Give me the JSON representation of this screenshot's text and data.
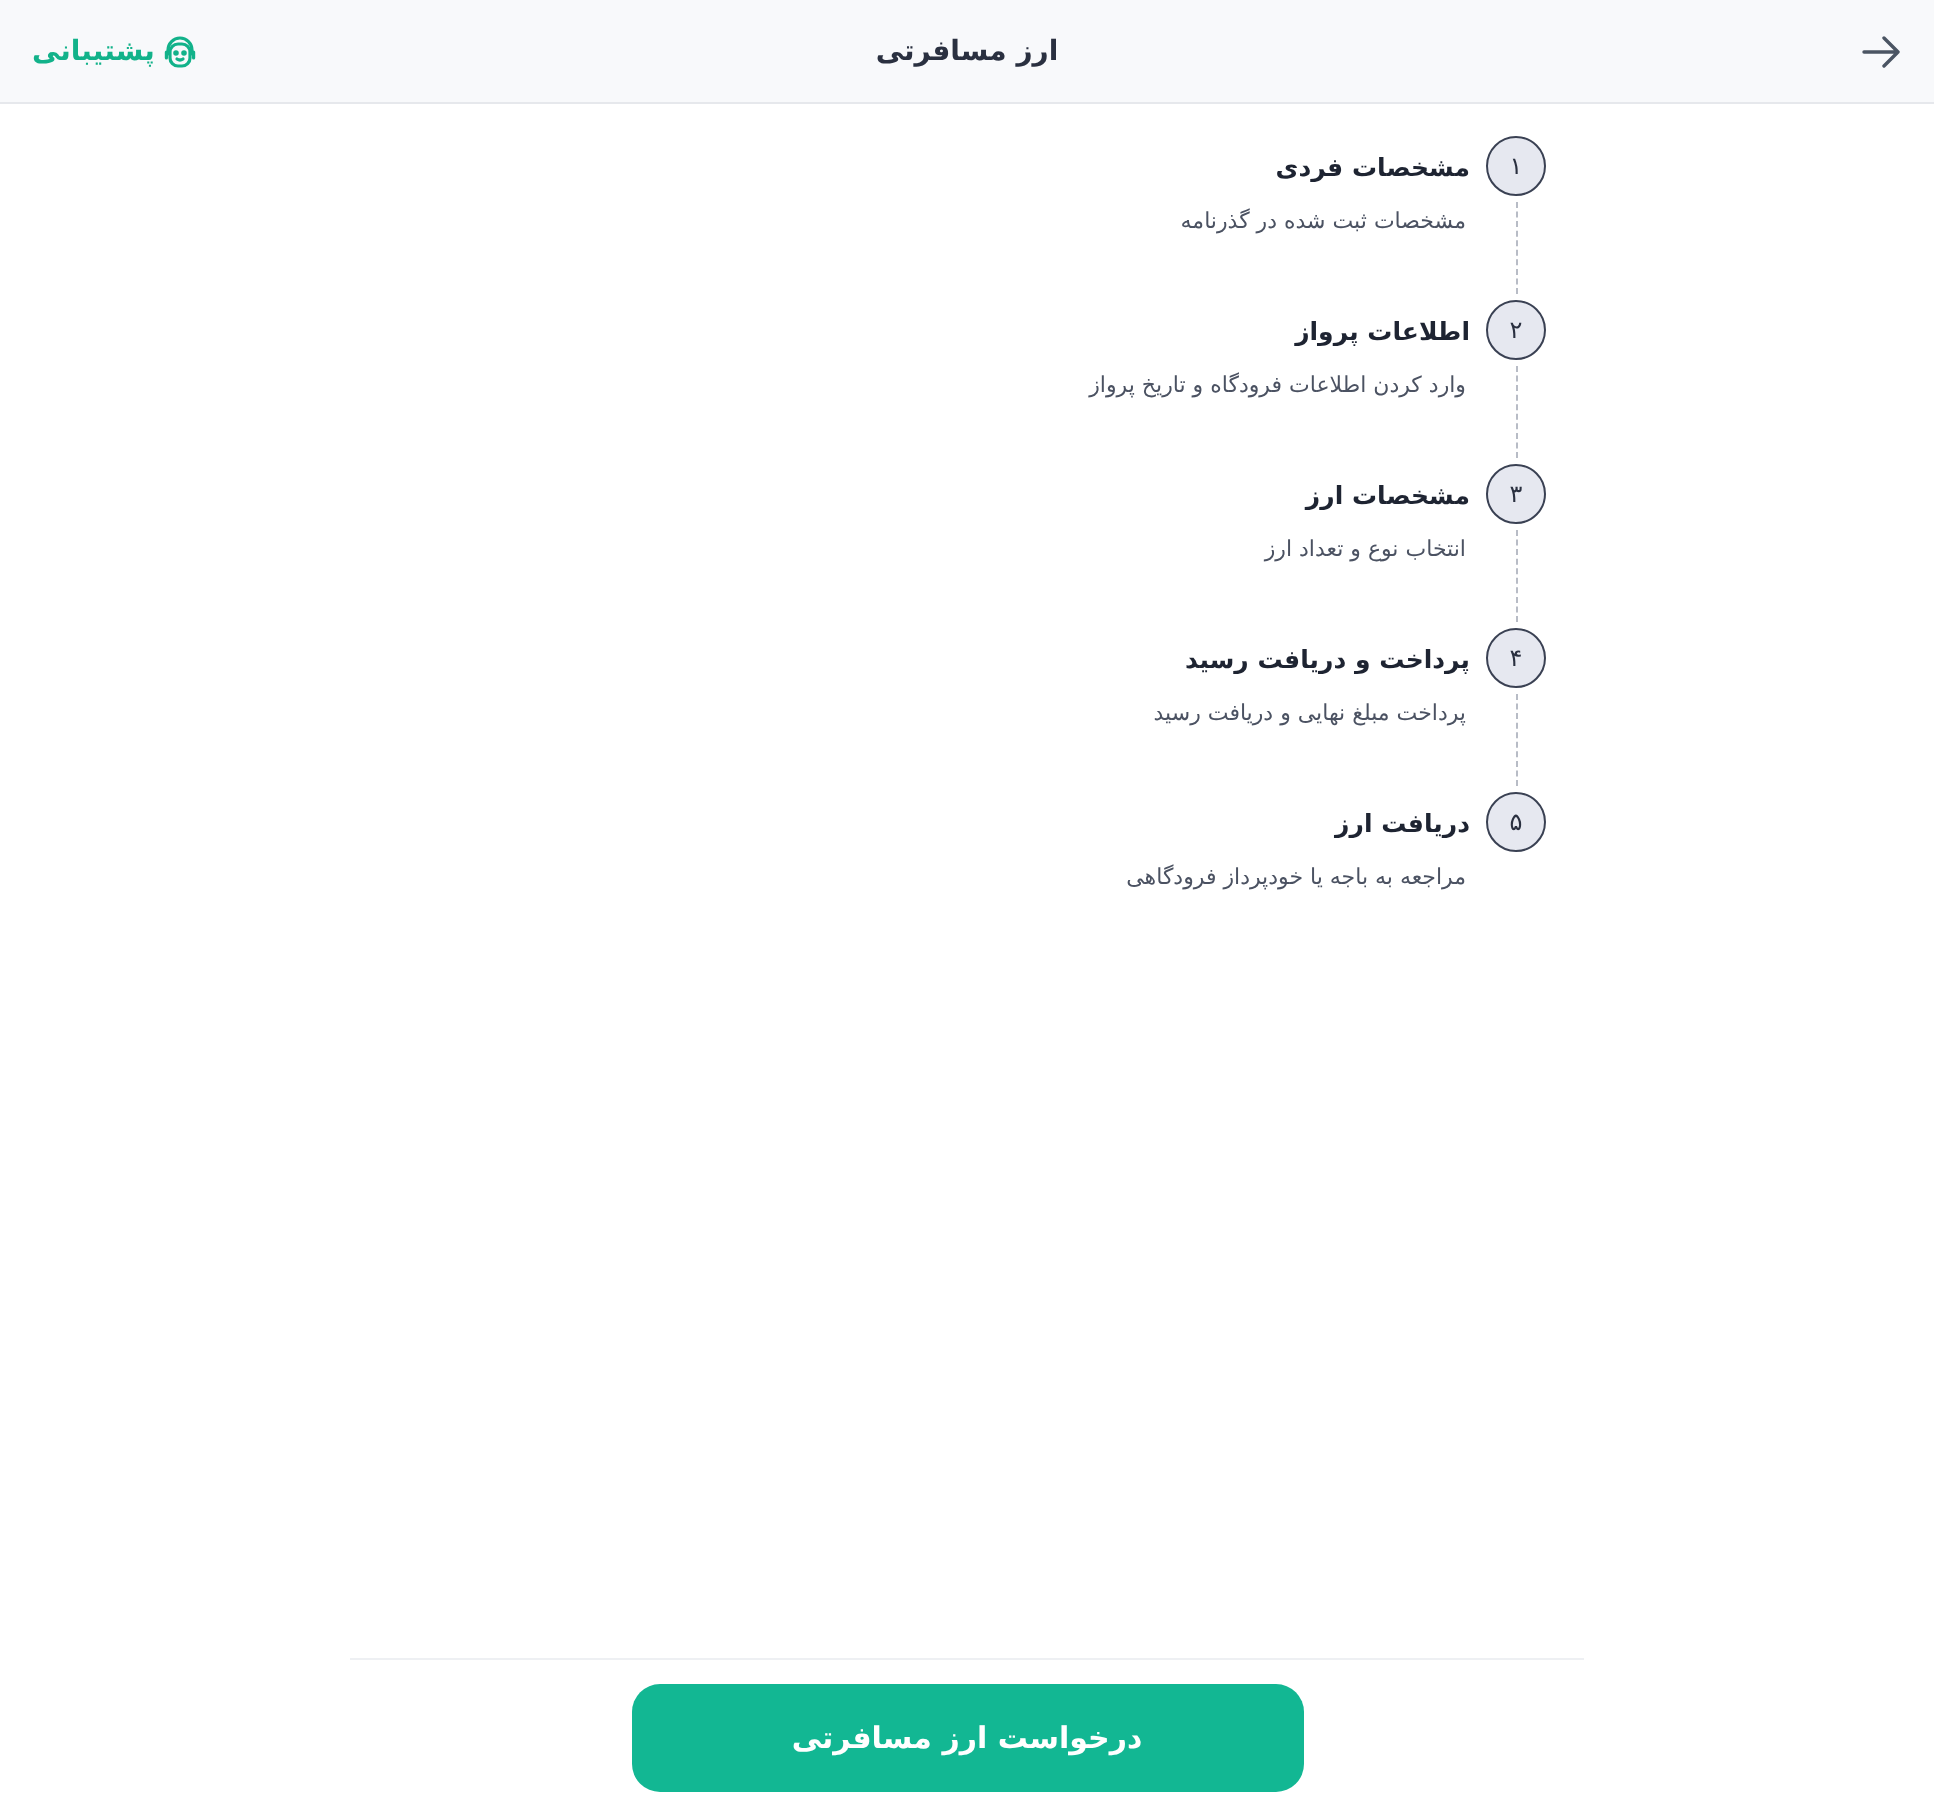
{
  "header": {
    "title": "ارز مسافرتی",
    "support_link": "پشتیبانی"
  },
  "steps": [
    {
      "number": "۱",
      "title": "مشخصات فردی",
      "description": "مشخصات ثبت شده در گذرنامه"
    },
    {
      "number": "۲",
      "title": "اطلاعات پرواز",
      "description": "وارد کردن اطلاعات فرودگاه و تاریخ پرواز"
    },
    {
      "number": "۳",
      "title": "مشخصات ارز",
      "description": "انتخاب نوع و تعداد ارز"
    },
    {
      "number": "۴",
      "title": "پرداخت و دریافت رسید",
      "description": "پرداخت مبلغ نهایی و دریافت رسید"
    },
    {
      "number": "۵",
      "title": "دریافت ارز",
      "description": "مراجعه به باجه یا خودپرداز فرودگاهی"
    }
  ],
  "primary_button": "درخواست ارز مسافرتی"
}
